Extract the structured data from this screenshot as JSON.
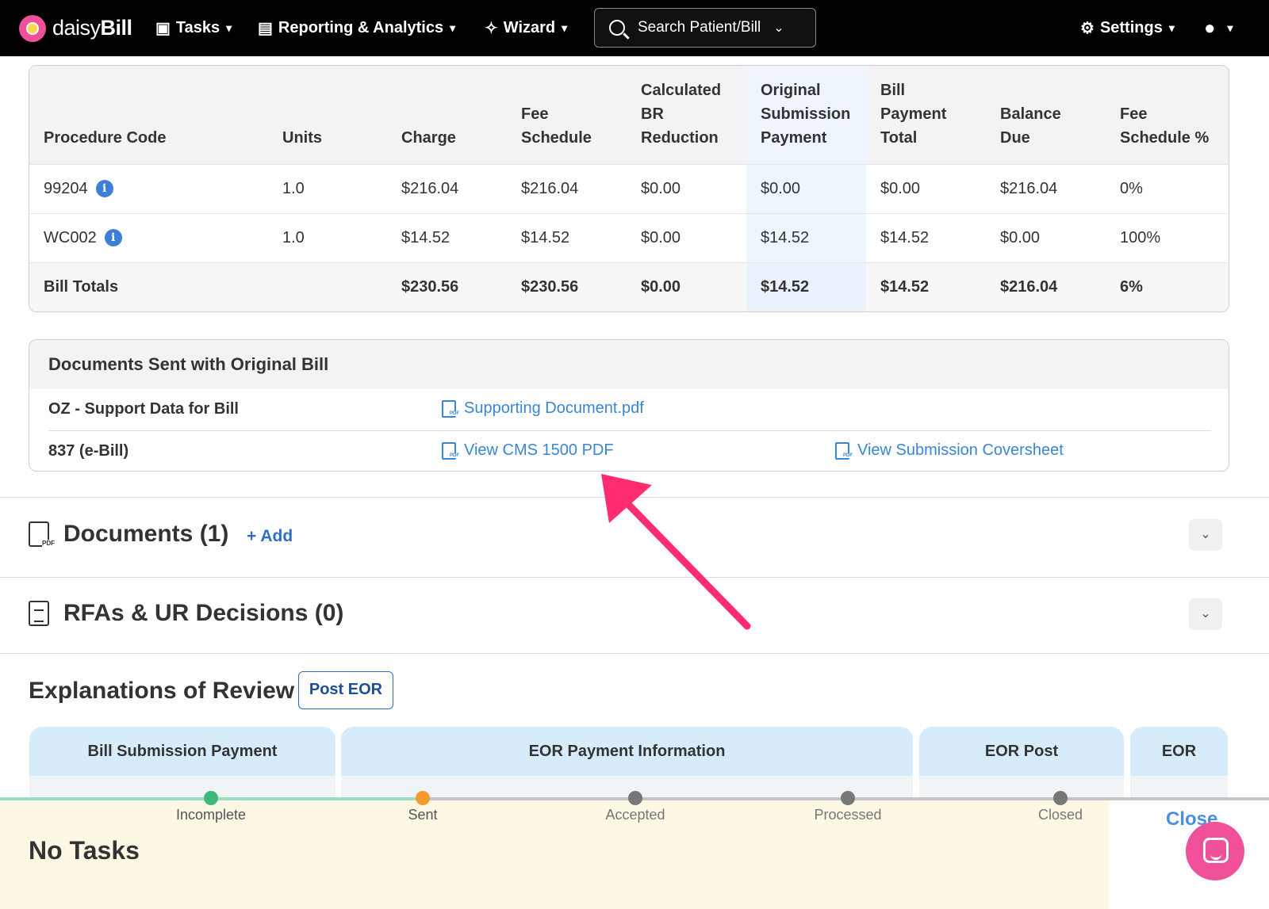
{
  "nav": {
    "brand_light": "daisy",
    "brand_bold": "Bill",
    "tasks": "Tasks",
    "reporting": "Reporting & Analytics",
    "wizard": "Wizard",
    "search_placeholder": "Search Patient/Bill",
    "settings": "Settings"
  },
  "procedures": {
    "headers": {
      "code": "Procedure Code",
      "units": "Units",
      "charge": "Charge",
      "fee_schedule_1": "Fee",
      "fee_schedule_2": "Schedule",
      "calc_1": "Calculated",
      "calc_2": "BR",
      "calc_3": "Reduction",
      "orig_1": "Original",
      "orig_2": "Submission",
      "orig_3": "Payment",
      "bpt_1": "Bill",
      "bpt_2": "Payment",
      "bpt_3": "Total",
      "bal_1": "Balance",
      "bal_2": "Due",
      "fsp_1": "Fee",
      "fsp_2": "Schedule %"
    },
    "rows": [
      {
        "code": "99204",
        "units": "1.0",
        "charge": "$216.04",
        "fee": "$216.04",
        "calc": "$0.00",
        "orig": "$0.00",
        "bpt": "$0.00",
        "balance": "$216.04",
        "pct": "0%"
      },
      {
        "code": "WC002",
        "units": "1.0",
        "charge": "$14.52",
        "fee": "$14.52",
        "calc": "$0.00",
        "orig": "$14.52",
        "bpt": "$14.52",
        "balance": "$0.00",
        "pct": "100%"
      }
    ],
    "totals": {
      "label": "Bill Totals",
      "charge": "$230.56",
      "fee": "$230.56",
      "calc": "$0.00",
      "orig": "$14.52",
      "bpt": "$14.52",
      "balance": "$216.04",
      "pct": "6%"
    }
  },
  "docs_sent": {
    "title": "Documents Sent with Original Bill",
    "rows": [
      {
        "label": "OZ - Support Data for Bill",
        "link1": "Supporting Document.pdf"
      },
      {
        "label": "837 (e-Bill)",
        "link1": "View CMS 1500 PDF",
        "link2": "View Submission Coversheet"
      }
    ]
  },
  "documents_section": {
    "title": "Documents (1)",
    "add": "Add"
  },
  "rfa_section": {
    "title": "RFAs & UR Decisions (0)"
  },
  "eor": {
    "title": "Explanations of Review",
    "post_button": "Post EOR",
    "tabs": [
      "Bill Submission Payment",
      "EOR Payment Information",
      "EOR Post",
      "EOR"
    ]
  },
  "progress": {
    "steps": [
      "Incomplete",
      "Sent",
      "Accepted",
      "Processed",
      "Closed"
    ],
    "current_index": 1
  },
  "tasks": {
    "empty": "No Tasks",
    "close": "Close"
  },
  "colors": {
    "accent": "#3a86d4",
    "brand_pink": "#f0509a",
    "arrow": "#ff2d6f"
  }
}
